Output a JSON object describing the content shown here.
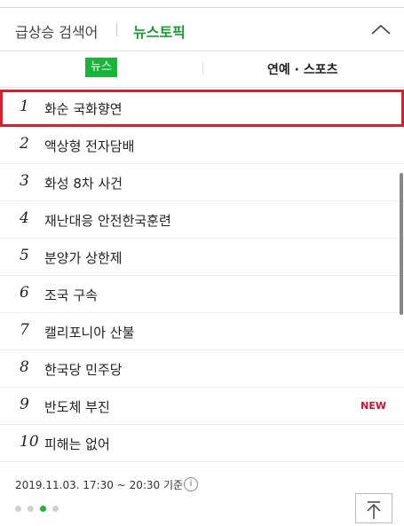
{
  "header": {
    "tab_trending": "급상승 검색어",
    "tab_news_topic": "뉴스토픽"
  },
  "subtabs": {
    "news": "뉴스",
    "entertainment": "연예 · 스포츠"
  },
  "list": [
    {
      "rank": "1",
      "keyword": "화순 국화향연",
      "badge": ""
    },
    {
      "rank": "2",
      "keyword": "액상형 전자담배",
      "badge": ""
    },
    {
      "rank": "3",
      "keyword": "화성 8차 사건",
      "badge": ""
    },
    {
      "rank": "4",
      "keyword": "재난대응 안전한국훈련",
      "badge": ""
    },
    {
      "rank": "5",
      "keyword": "분양가 상한제",
      "badge": ""
    },
    {
      "rank": "6",
      "keyword": "조국 구속",
      "badge": ""
    },
    {
      "rank": "7",
      "keyword": "캘리포니아 산불",
      "badge": ""
    },
    {
      "rank": "8",
      "keyword": "한국당 민주당",
      "badge": ""
    },
    {
      "rank": "9",
      "keyword": "반도체 부진",
      "badge": "NEW"
    },
    {
      "rank": "10",
      "keyword": "피해는 없어",
      "badge": ""
    }
  ],
  "footer": {
    "timestamp": "2019.11.03. 17:30 ~ 20:30 기준",
    "info_glyph": "i"
  },
  "colors": {
    "accent_green": "#19b43a",
    "highlight_red": "#d4202f",
    "new_badge": "#c8102e"
  }
}
